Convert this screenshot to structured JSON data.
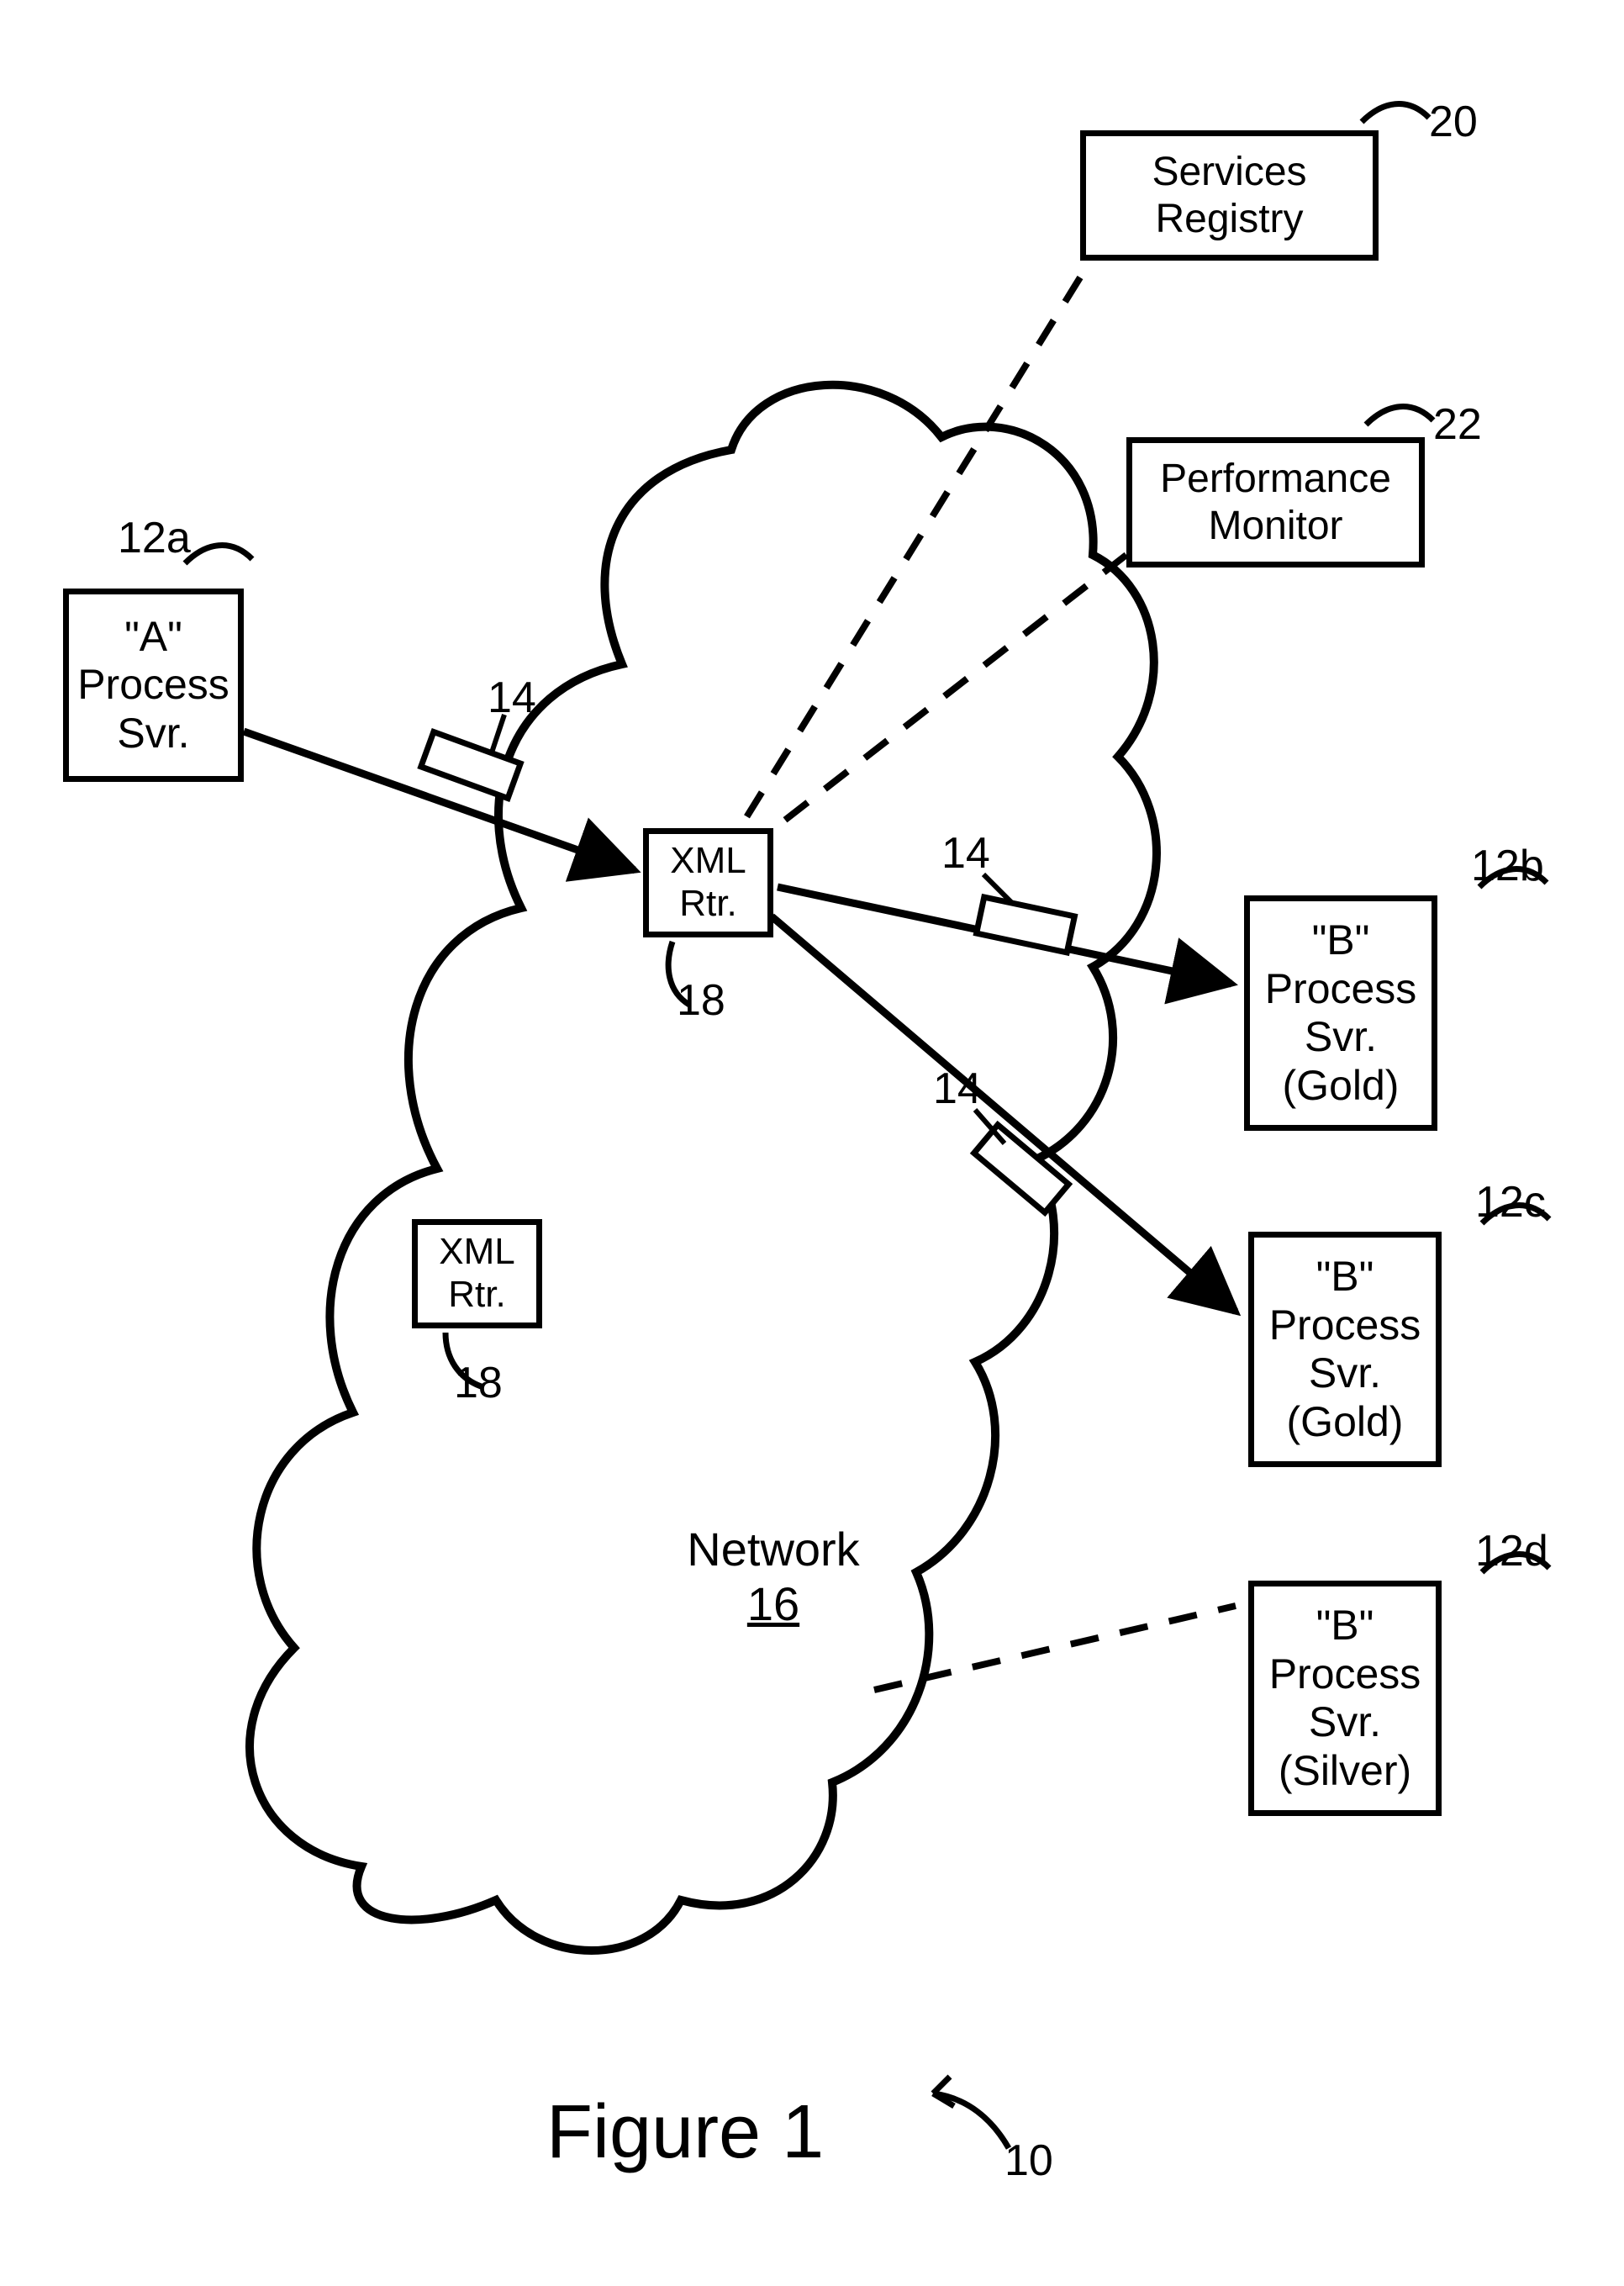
{
  "figure_caption": "Figure 1",
  "figure_ref": "10",
  "network": {
    "label": "Network",
    "number": "16"
  },
  "routers": {
    "r1": {
      "line1": "XML",
      "line2": "Rtr.",
      "ref": "18"
    },
    "r2": {
      "line1": "XML",
      "line2": "Rtr.",
      "ref": "18"
    }
  },
  "nodes": {
    "a": {
      "line1": "\"A\"",
      "line2": "Process",
      "line3": "Svr.",
      "ref": "12a"
    },
    "b": {
      "line1": "\"B\"",
      "line2": "Process",
      "line3": "Svr.",
      "line4": "(Gold)",
      "ref": "12b"
    },
    "c": {
      "line1": "\"B\"",
      "line2": "Process",
      "line3": "Svr.",
      "line4": "(Gold)",
      "ref": "12c"
    },
    "d": {
      "line1": "\"B\"",
      "line2": "Process",
      "line3": "Svr.",
      "line4": "(Silver)",
      "ref": "12d"
    },
    "svc": {
      "line1": "Services",
      "line2": "Registry",
      "ref": "20"
    },
    "pm": {
      "line1": "Performance",
      "line2": "Monitor",
      "ref": "22"
    }
  },
  "msg_refs": {
    "m1": "14",
    "m2": "14",
    "m3": "14"
  }
}
